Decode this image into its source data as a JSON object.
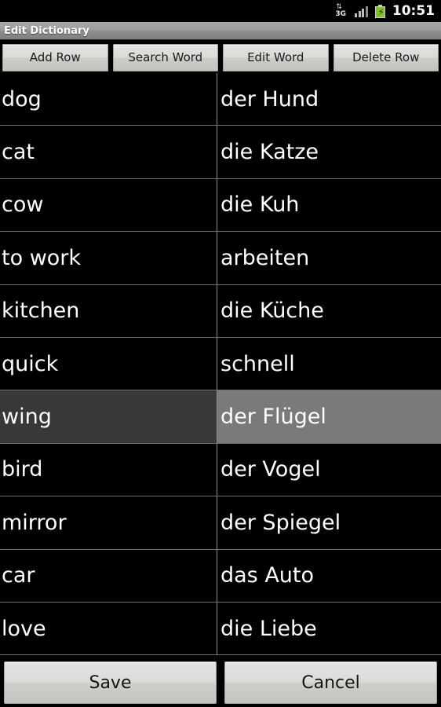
{
  "status_bar": {
    "network_icon": "3g-data-icon",
    "network_label": "3G",
    "network_arrows": "⇅",
    "signal_icon": "signal-bars-icon",
    "battery_icon": "battery-charging-icon",
    "battery_bolt": "⚡",
    "time": "10:51"
  },
  "title_bar": {
    "title": "Edit Dictionary"
  },
  "toolbar": {
    "buttons": [
      {
        "label": "Add Row"
      },
      {
        "label": "Search Word"
      },
      {
        "label": "Edit Word"
      },
      {
        "label": "Delete Row"
      }
    ]
  },
  "table": {
    "selected_row_index": 6,
    "colors": {
      "background": "#000000",
      "text": "#ffffff",
      "divider": "#6f6f6f",
      "selected_left_cell": "#383838",
      "selected_right_cell": "#7a7a7a"
    },
    "rows": [
      {
        "english": "dog",
        "german": "der Hund"
      },
      {
        "english": "cat",
        "german": "die Katze"
      },
      {
        "english": "cow",
        "german": "die Kuh"
      },
      {
        "english": "to work",
        "german": "arbeiten"
      },
      {
        "english": "kitchen",
        "german": "die Küche"
      },
      {
        "english": "quick",
        "german": "schnell"
      },
      {
        "english": "wing",
        "german": "der Flügel"
      },
      {
        "english": "bird",
        "german": "der Vogel"
      },
      {
        "english": "mirror",
        "german": "der Spiegel"
      },
      {
        "english": "car",
        "german": "das Auto"
      },
      {
        "english": "love",
        "german": "die Liebe"
      }
    ]
  },
  "bottom_bar": {
    "save_label": "Save",
    "cancel_label": "Cancel"
  }
}
